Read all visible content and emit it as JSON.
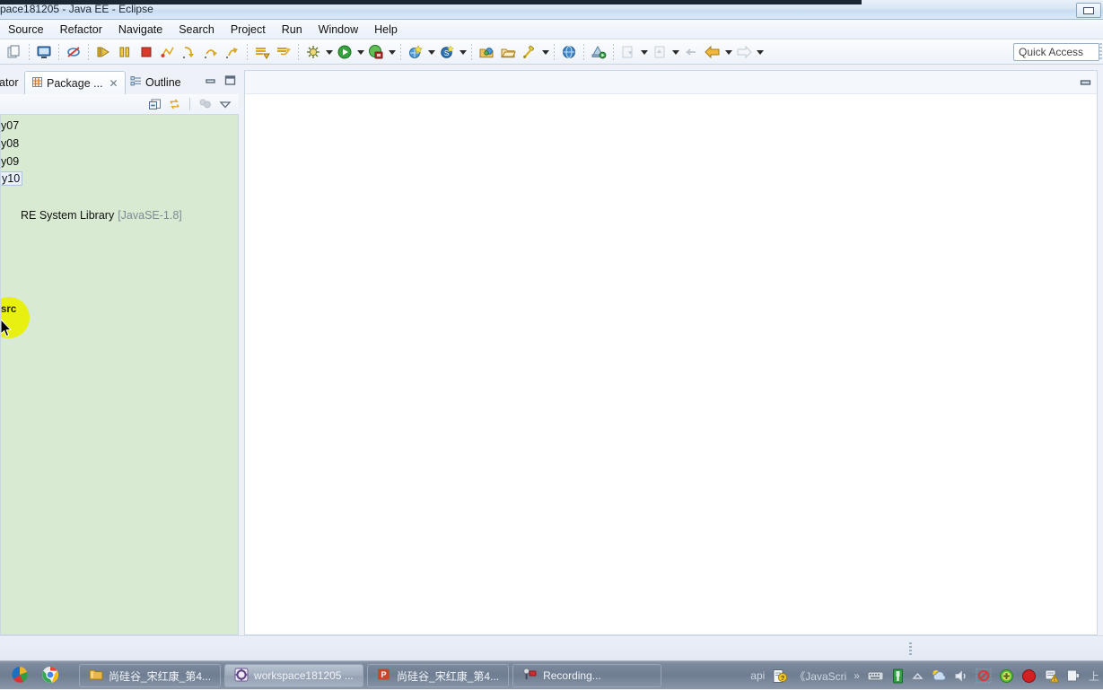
{
  "window": {
    "title": "pace181205 - Java EE - Eclipse",
    "restore_button": "restore-window"
  },
  "menu": {
    "items": [
      {
        "label": "Source"
      },
      {
        "label": "Refactor"
      },
      {
        "label": "Navigate"
      },
      {
        "label": "Search"
      },
      {
        "label": "Project"
      },
      {
        "label": "Run"
      },
      {
        "label": "Window"
      },
      {
        "label": "Help"
      }
    ]
  },
  "toolbar": {
    "quick_access": "Quick Access",
    "groups": [
      {
        "icons": [
          "copy-icon"
        ]
      },
      {
        "icons": [
          "new-java-ee-icon",
          "skip-breakpoints-icon"
        ]
      },
      {
        "icons": [
          "resume-icon",
          "suspend-icon",
          "terminate-icon",
          "disconnect-icon",
          "step-into-icon",
          "step-over-icon",
          "step-return-icon"
        ]
      },
      {
        "icons": [
          "save-icon",
          "save-all-icon"
        ]
      },
      {
        "icons": [
          "debug-icon",
          "run-icon",
          "coverage-icon"
        ]
      },
      {
        "icons": [
          "new-wizard-icon",
          "new-element-icon"
        ]
      },
      {
        "icons": [
          "open-package-icon",
          "open-type-icon",
          "search-icon"
        ]
      },
      {
        "icons": [
          "web-browser-icon"
        ]
      },
      {
        "icons": [
          "run-as-server-icon"
        ]
      },
      {
        "icons": [
          "next-annotation-icon",
          "previous-annotation-icon"
        ]
      },
      {
        "icons": [
          "back-icon",
          "forward-icon"
        ]
      }
    ]
  },
  "view_stack": {
    "tabs": [
      {
        "label": "ator",
        "icon": "navigator-icon",
        "active": false,
        "closable": false
      },
      {
        "label": "Package ...",
        "icon": "package-explorer-icon",
        "active": true,
        "closable": true,
        "close_glyph": "✕"
      },
      {
        "label": "Outline",
        "icon": "outline-icon",
        "active": false,
        "closable": false
      }
    ],
    "stack_buttons": [
      "minimize-icon",
      "maximize-icon"
    ],
    "view_toolbar": [
      "collapse-all-icon",
      "link-with-editor-icon",
      "focus-on-active-task-icon",
      "view-menu-icon"
    ]
  },
  "tree": {
    "rows": [
      {
        "label": "y07",
        "selected": false,
        "suffix": ""
      },
      {
        "label": "y08",
        "selected": false,
        "suffix": ""
      },
      {
        "label": "y09",
        "selected": false,
        "suffix": ""
      },
      {
        "label": "y10",
        "selected": true,
        "suffix": ""
      },
      {
        "label": "src",
        "selected": false,
        "suffix": "",
        "highlighted": true
      },
      {
        "label": "RE System Library",
        "selected": false,
        "suffix": "[JavaSE-1.8]"
      }
    ],
    "background_color": "#d9ead3",
    "highlight_color": "#e8f000"
  },
  "editor": {
    "empty": "",
    "minimize_button": "minimize-editor-area"
  },
  "statusbar": {
    "text": ""
  },
  "taskbar": {
    "quick_launch": [
      {
        "icon": "pinwheel-icon"
      },
      {
        "icon": "chrome-icon"
      }
    ],
    "tasks": [
      {
        "icon": "folder-icon",
        "label": "尚硅谷_宋红康_第4..."
      },
      {
        "icon": "eclipse-workspace-icon",
        "label": "workspace181205 ..."
      },
      {
        "icon": "powerpoint-icon",
        "label": "尚硅谷_宋红康_第4..."
      },
      {
        "icon": "recorder-icon",
        "label": "Recording..."
      }
    ],
    "tray": [
      {
        "type": "text",
        "label": "api"
      },
      {
        "type": "icon",
        "icon": "help-doc-icon"
      },
      {
        "type": "text",
        "label": "《JavaScri"
      },
      {
        "type": "text",
        "label": "»"
      },
      {
        "type": "icon",
        "icon": "keyboard-icon"
      },
      {
        "type": "icon",
        "icon": "usb-icon"
      },
      {
        "type": "icon",
        "icon": "show-hidden-icons-icon"
      },
      {
        "type": "icon",
        "icon": "weather-icon"
      },
      {
        "type": "icon",
        "icon": "volume-icon"
      },
      {
        "type": "icon",
        "icon": "block-icon"
      },
      {
        "type": "icon",
        "icon": "green-plus-icon"
      },
      {
        "type": "icon",
        "icon": "record-stop-icon"
      },
      {
        "type": "icon",
        "icon": "warning-network-icon"
      },
      {
        "type": "icon",
        "icon": "plug-icon"
      },
      {
        "type": "text",
        "label": "上"
      }
    ]
  }
}
